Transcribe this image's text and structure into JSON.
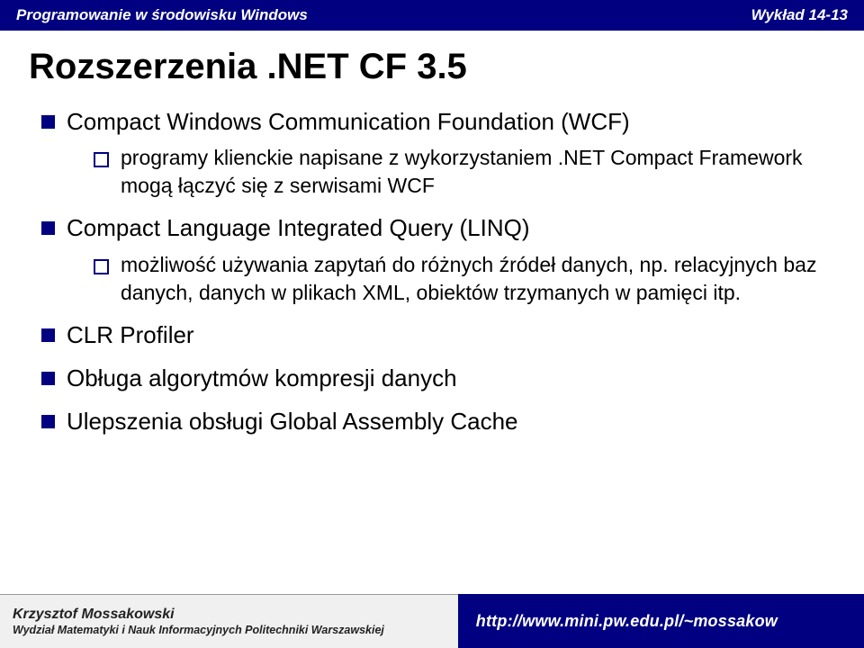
{
  "header": {
    "left": "Programowanie w środowisku Windows",
    "right": "Wykład 14-13"
  },
  "title": "Rozszerzenia .NET CF 3.5",
  "bullets": [
    {
      "text": "Compact Windows Communication Foundation (WCF)",
      "sub": [
        {
          "text": "programy klienckie napisane z wykorzystaniem .NET Compact Framework mogą łączyć się z serwisami WCF"
        }
      ]
    },
    {
      "text": "Compact Language Integrated Query (LINQ)",
      "sub": [
        {
          "text": "możliwość używania zapytań do różnych źródeł danych, np. relacyjnych baz danych, danych w plikach XML, obiektów trzymanych w pamięci itp."
        }
      ]
    },
    {
      "text": "CLR Profiler",
      "sub": []
    },
    {
      "text": "Obługa algorytmów kompresji danych",
      "sub": []
    },
    {
      "text": "Ulepszenia obsługi Global Assembly Cache",
      "sub": []
    }
  ],
  "footer": {
    "author": "Krzysztof Mossakowski",
    "dept": "Wydział Matematyki i Nauk Informacyjnych Politechniki Warszawskiej",
    "url": "http://www.mini.pw.edu.pl/~mossakow"
  }
}
